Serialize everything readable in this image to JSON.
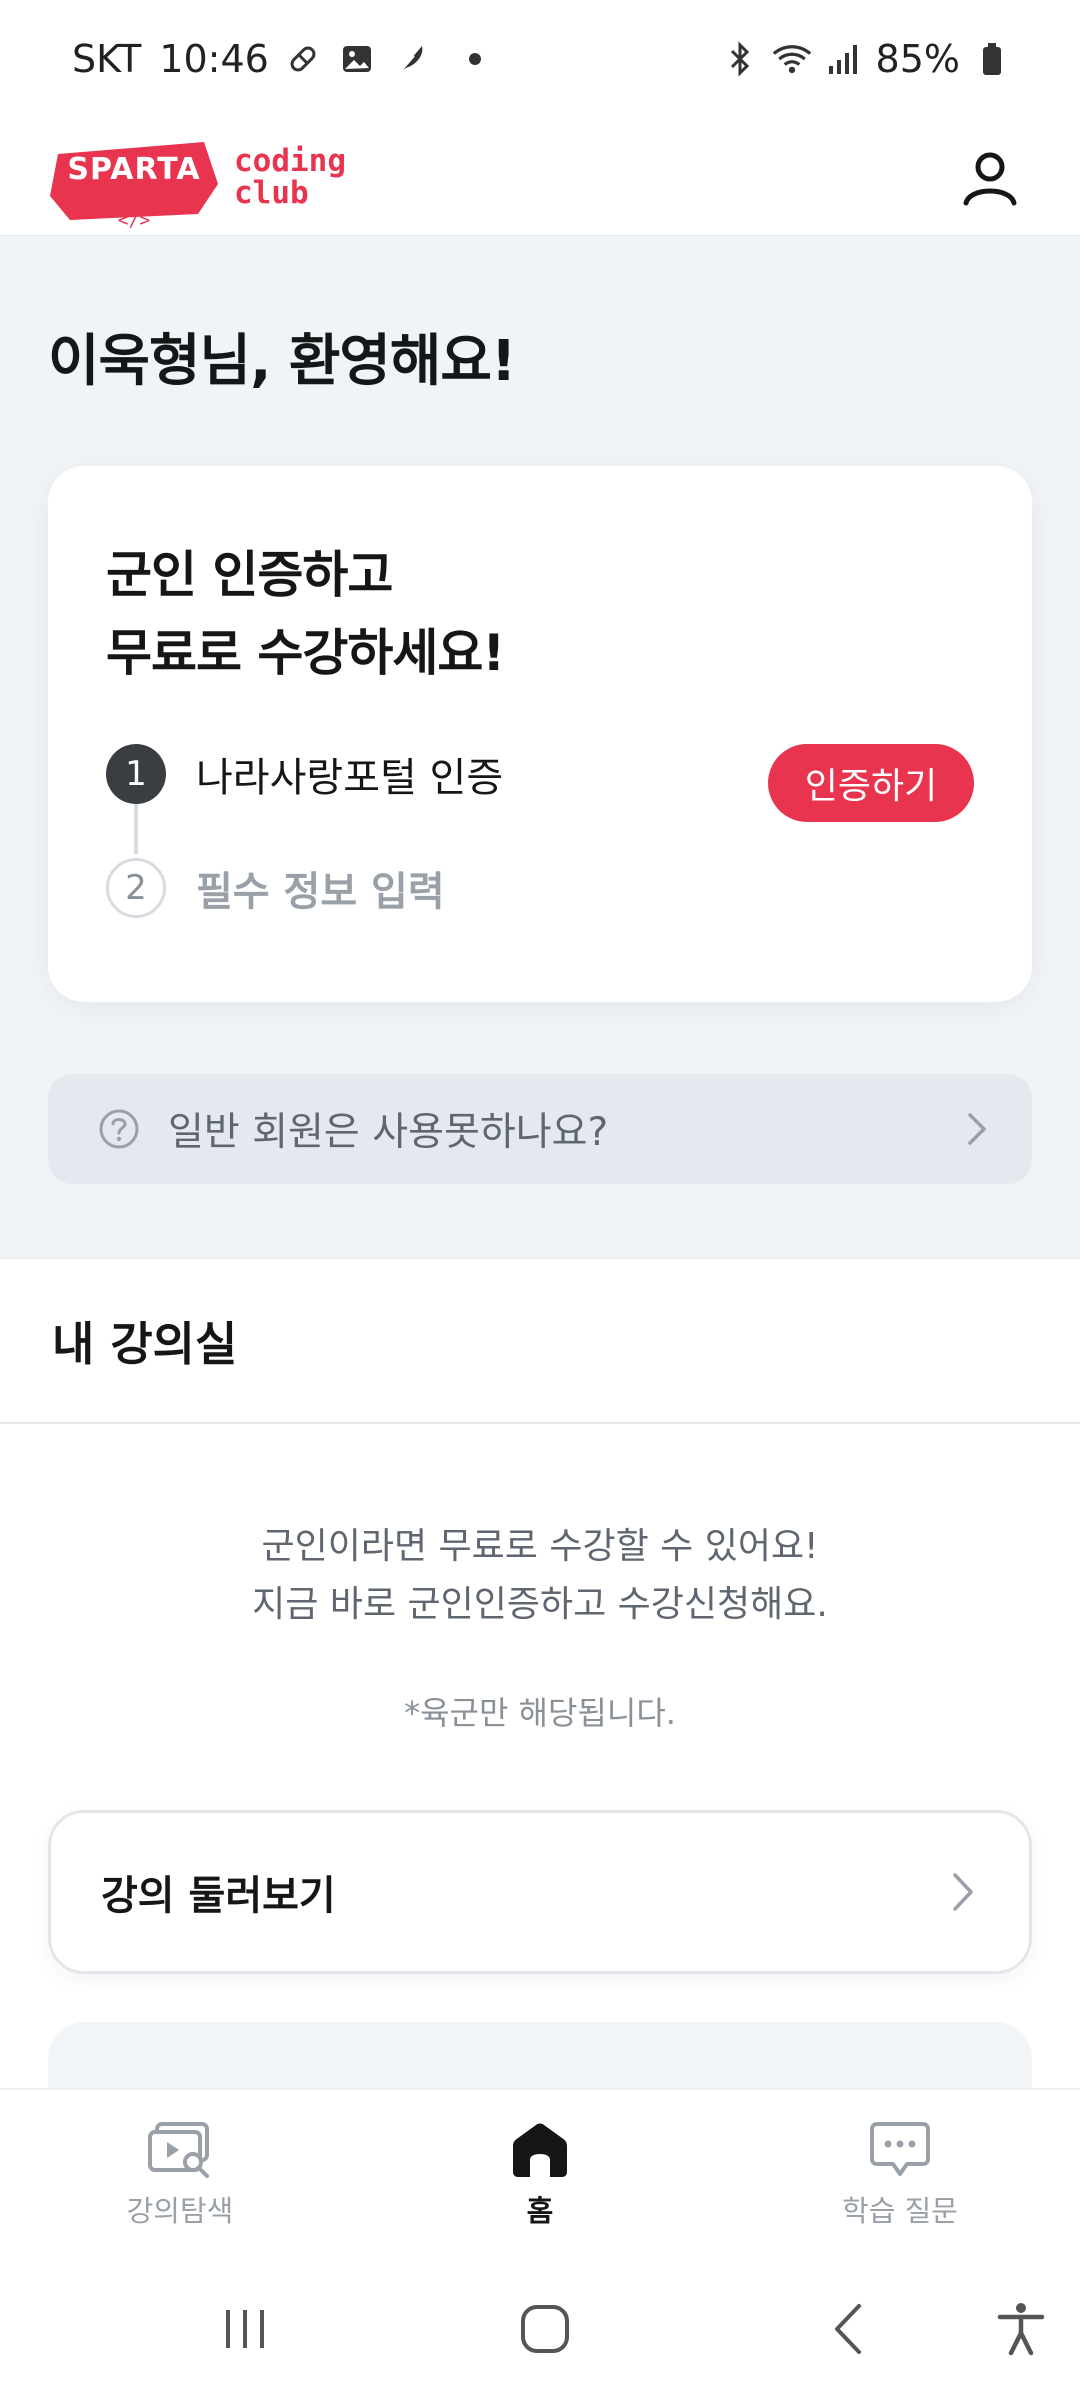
{
  "status_bar": {
    "carrier": "SKT",
    "time": "10:46",
    "battery": "85%",
    "icons": [
      "pill-icon",
      "gallery-icon",
      "feather-icon",
      "dot-icon",
      "bluetooth-icon",
      "wifi-icon",
      "signal-icon",
      "battery-icon"
    ]
  },
  "header": {
    "logo_badge": "SPARTA",
    "logo_text_line1": "coding",
    "logo_text_line2": "club",
    "brand_color": "#e8344e",
    "profile_icon": "person-icon"
  },
  "greeting": "이욱형님, 환영해요!",
  "cert_card": {
    "title_line1": "군인 인증하고",
    "title_line2": "무료로 수강하세요!",
    "steps": [
      {
        "number": "1",
        "label": "나라사랑포털 인증",
        "active": true
      },
      {
        "number": "2",
        "label": "필수 정보 입력",
        "active": false
      }
    ],
    "button_label": "인증하기"
  },
  "faq": {
    "text": "일반 회원은 사용못하나요?",
    "icon": "question-circle-icon"
  },
  "classroom": {
    "title": "내 강의실",
    "info_line1": "군인이라면 무료로 수강할 수 있어요!",
    "info_line2": "지금 바로 군인인증하고 수강신청해요.",
    "note": "*육군만 해당됩니다.",
    "browse_label": "강의 둘러보기"
  },
  "bottom_nav": {
    "items": [
      {
        "label": "강의탐색",
        "icon": "video-search-icon",
        "active": false
      },
      {
        "label": "홈",
        "icon": "home-icon",
        "active": true
      },
      {
        "label": "학습 질문",
        "icon": "chat-bubble-icon",
        "active": false
      }
    ]
  },
  "system_nav": {
    "icons": [
      "recents-icon",
      "home-circle-icon",
      "back-icon",
      "accessibility-icon"
    ]
  }
}
